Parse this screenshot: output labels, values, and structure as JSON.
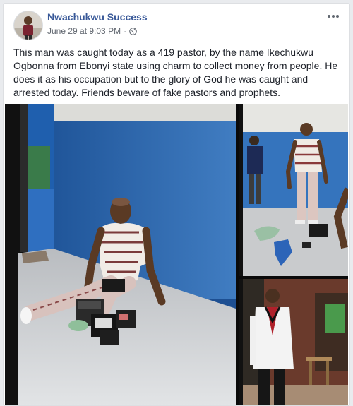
{
  "post": {
    "author": "Nwachukwu Success",
    "timestamp": "June 29 at 9:03 PM",
    "separator": "·",
    "privacy_icon": "globe-icon",
    "menu_icon": "more-options-icon",
    "text": "This man was caught today as a 419 pastor, by the name Ikechukwu Ogbonna from Ebonyi state using charm to collect money from people. He does it as his occupation but to the glory of God he was caught and arrested today. Friends beware of fake pastors and prophets."
  },
  "colors": {
    "author_link": "#385898",
    "meta_text": "#616770",
    "body_text": "#1d2129",
    "wall_blue": "#2a6ab3"
  },
  "photos": [
    {
      "name": "man-sitting-against-wall"
    },
    {
      "name": "man-standing-items-floor"
    },
    {
      "name": "man-white-suit"
    }
  ]
}
